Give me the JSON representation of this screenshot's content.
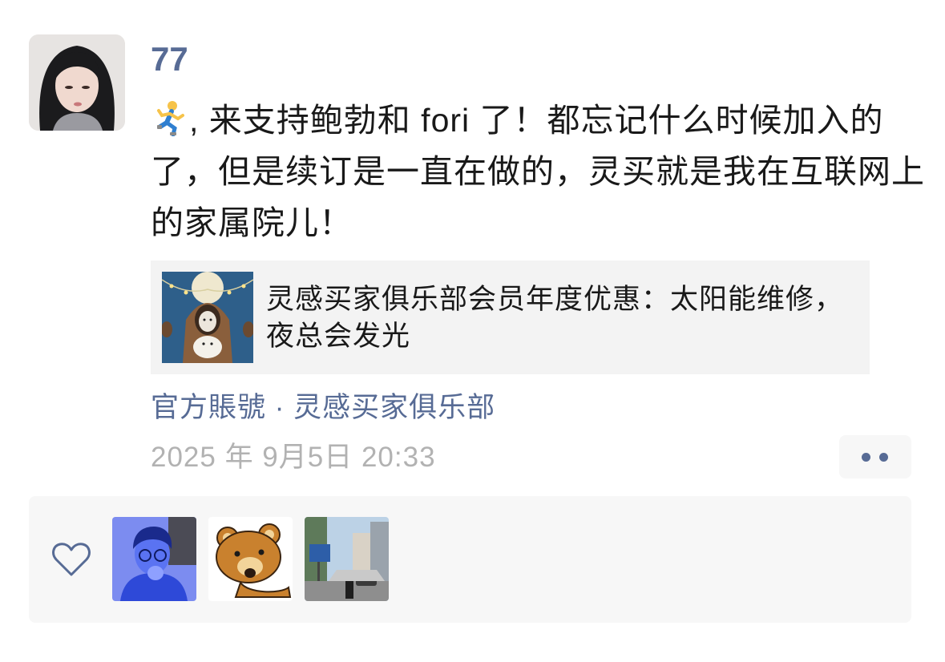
{
  "post": {
    "username": "77",
    "emoji": "runner-emoji",
    "text": ", 来支持鲍勃和 fori 了！都忘记什么时候加入的了，但是续订是一直在做的，灵买就是我在互联网上的家属院儿！",
    "shared": {
      "title": "灵感买家俱乐部会员年度优惠：太阳能维修，夜总会发光"
    },
    "source": "官方賬號 · 灵感买家俱乐部",
    "timestamp": "2025 年 9月5日 20:33"
  },
  "likes": {
    "icon": "heart-icon",
    "avatars": [
      "blue-avatar",
      "bear-avatar",
      "street-avatar"
    ]
  },
  "colors": {
    "link": "#576b95",
    "text": "#191919",
    "muted": "#b2b2b2",
    "card_bg": "#f3f3f3",
    "likes_bg": "#f7f7f7"
  }
}
